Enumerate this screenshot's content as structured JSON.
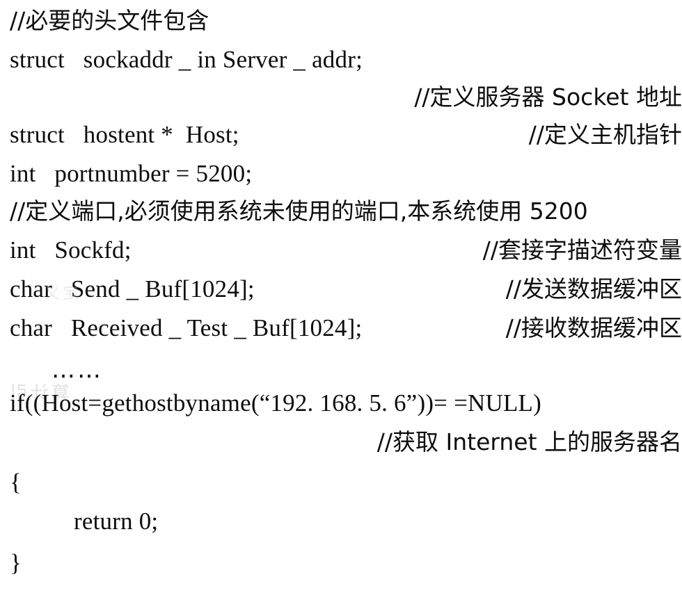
{
  "page": {
    "kind": "scanned-code-listing",
    "background_color": "#ffffff",
    "text_color": "#0d0d0d",
    "faint_bleed_color": "#c9c9c9"
  },
  "code_lines": [
    {
      "id": "comment-headers",
      "align": "left",
      "text": "//必要的头文件包含"
    },
    {
      "id": "decl-server-addr",
      "align": "left",
      "text": "struct   sockaddr _ in Server _ addr;"
    },
    {
      "id": "comment-server-addr",
      "align": "right",
      "text": "//定义服务器 Socket 地址"
    },
    {
      "id": "decl-host",
      "align": "left",
      "text": "struct   hostent *  Host;"
    },
    {
      "id": "comment-host",
      "align": "right",
      "text": "//定义主机指针"
    },
    {
      "id": "decl-portnumber",
      "align": "left",
      "text": "int   portnumber = 5200;"
    },
    {
      "id": "comment-portnumber",
      "align": "left",
      "text": "//定义端口,必须使用系统未使用的端口,本系统使用 5200"
    },
    {
      "id": "decl-sockfd",
      "align": "left",
      "text": "int   Sockfd;"
    },
    {
      "id": "comment-sockfd",
      "align": "right",
      "text": "//套接字描述符变量"
    },
    {
      "id": "decl-send-buf",
      "align": "left",
      "text": "char   Send _ Buf[1024];"
    },
    {
      "id": "comment-send-buf",
      "align": "right",
      "text": "//发送数据缓冲区"
    },
    {
      "id": "decl-received-buf",
      "align": "left",
      "text": "char   Received _ Test _ Buf[1024];"
    },
    {
      "id": "comment-received-buf",
      "align": "right",
      "text": "//接收数据缓冲区"
    },
    {
      "id": "ellipsis",
      "align": "left",
      "text": "……"
    },
    {
      "id": "if-gethostbyname",
      "align": "left",
      "text": "if((Host=gethostbyname(“192. 168. 5. 6”))= =NULL)"
    },
    {
      "id": "comment-internet",
      "align": "right",
      "text": "//获取 Internet 上的服务器名"
    },
    {
      "id": "brace-open",
      "align": "left",
      "text": "{"
    },
    {
      "id": "return-zero",
      "align": "left",
      "text": "return 0;"
    },
    {
      "id": "brace-close",
      "align": "left",
      "text": "}"
    }
  ],
  "artifacts": {
    "bleed_through_a": "算计引",
    "bleed_through_b": "定义"
  }
}
